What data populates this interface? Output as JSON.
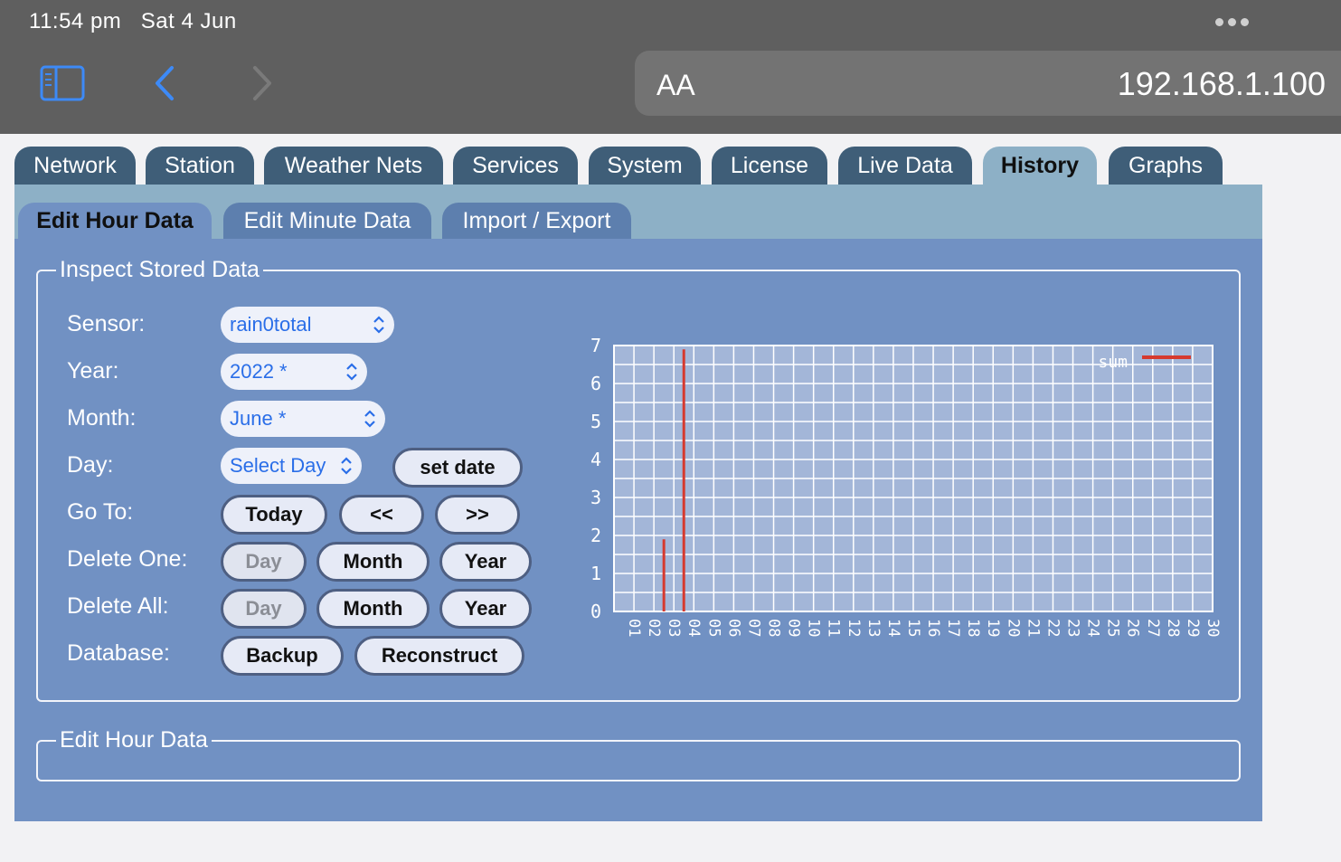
{
  "status": {
    "time": "11:54 pm   Sat 4 Jun"
  },
  "browser": {
    "aa": "AA",
    "url": "192.168.1.100"
  },
  "tabs": [
    "Network",
    "Station",
    "Weather Nets",
    "Services",
    "System",
    "License",
    "Live Data",
    "History",
    "Graphs"
  ],
  "active_tab": "History",
  "subtabs": [
    "Edit Hour Data",
    "Edit Minute Data",
    "Import / Export"
  ],
  "active_subtab": "Edit Hour Data",
  "inspect": {
    "legend": "Inspect Stored Data",
    "sensor_label": "Sensor:",
    "sensor_value": "rain0total",
    "year_label": "Year:",
    "year_value": "2022 *",
    "month_label": "Month:",
    "month_value": "June *",
    "day_label": "Day:",
    "day_value": "Select Day",
    "set_date": "set date",
    "goto_label": "Go To:",
    "today": "Today",
    "prev": "<<",
    "next": ">>",
    "delete_one_label": "Delete One:",
    "delete_all_label": "Delete All:",
    "day": "Day",
    "month": "Month",
    "year": "Year",
    "database_label": "Database:",
    "backup": "Backup",
    "reconstruct": "Reconstruct"
  },
  "edit_hour": {
    "legend": "Edit Hour Data"
  },
  "colors": {
    "chart_bg": "#a3b6d8",
    "grid": "#ffffff",
    "series": "#d63a2f"
  },
  "chart_data": {
    "type": "bar",
    "categories": [
      "01",
      "02",
      "03",
      "04",
      "05",
      "06",
      "07",
      "08",
      "09",
      "10",
      "11",
      "12",
      "13",
      "14",
      "15",
      "16",
      "17",
      "18",
      "19",
      "20",
      "21",
      "22",
      "23",
      "24",
      "25",
      "26",
      "27",
      "28",
      "29",
      "30"
    ],
    "series": [
      {
        "name": "sum",
        "values": [
          0,
          0,
          1.9,
          6.9,
          0,
          0,
          0,
          0,
          0,
          0,
          0,
          0,
          0,
          0,
          0,
          0,
          0,
          0,
          0,
          0,
          0,
          0,
          0,
          0,
          0,
          0,
          0,
          0,
          0,
          0
        ]
      }
    ],
    "yticks": [
      0,
      1,
      2,
      3,
      4,
      5,
      6,
      7
    ],
    "ylim": [
      0,
      7
    ],
    "legend": "top-right",
    "grid": true
  }
}
